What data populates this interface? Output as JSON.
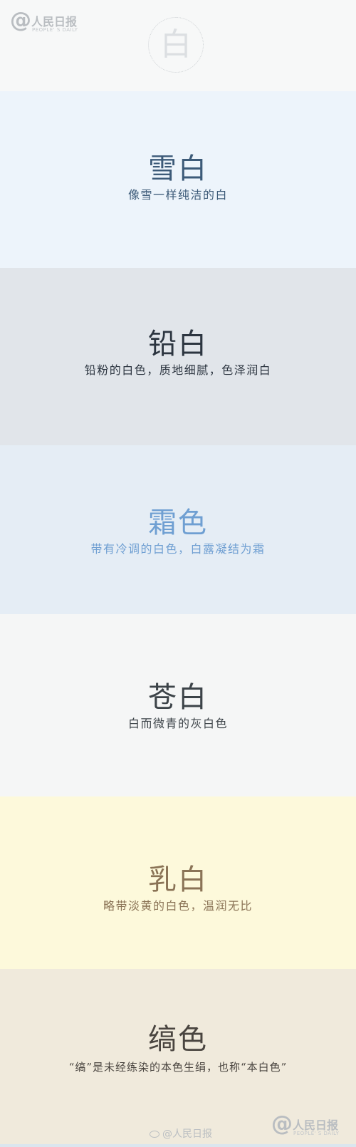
{
  "brand": {
    "at": "@",
    "cn": "人民日报",
    "en": "PEOPLE' S DAILY"
  },
  "emblem": {
    "char": "白"
  },
  "sections": [
    {
      "title": "雪白",
      "subtitle": "像雪一样纯洁的白",
      "bg": "#edf4fb",
      "color": "#3c5a78"
    },
    {
      "title": "铅白",
      "subtitle": "铅粉的白色，质地细腻，色泽润白",
      "bg": "#e1e5ea",
      "color": "#2c3540"
    },
    {
      "title": "霜色",
      "subtitle": "带有冷调的白色，白露凝结为霜",
      "bg": "#e5edf5",
      "color": "#6f9fd2"
    },
    {
      "title": "苍白",
      "subtitle": "白而微青的灰白色",
      "bg": "#f5f6f6",
      "color": "#3c4348"
    },
    {
      "title": "乳白",
      "subtitle": "略带淡黄的白色，温润无比",
      "bg": "#fdf9db",
      "color": "#8a7356"
    },
    {
      "title": "缟色",
      "subtitle": "“缟”是未经练染的本色生绢，也称“本白色”",
      "bg": "#f0eadc",
      "color": "#4a4540"
    }
  ],
  "footer": {
    "watermark": "@人民日报"
  }
}
